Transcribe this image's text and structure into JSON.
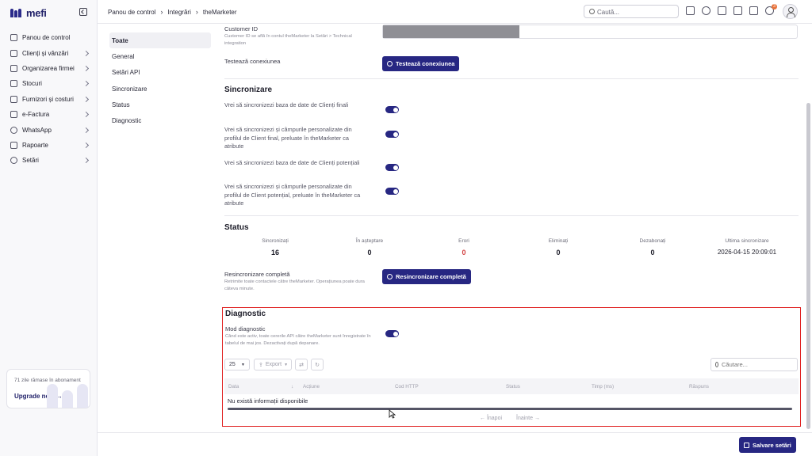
{
  "app": {
    "logo_text": "mefi"
  },
  "sidebar": {
    "items": [
      {
        "label": "Panou de control",
        "icon": "home-icon",
        "chevron": false
      },
      {
        "label": "Clienți și vânzări",
        "icon": "users-icon",
        "chevron": true
      },
      {
        "label": "Organizarea firmei",
        "icon": "building-icon",
        "chevron": true
      },
      {
        "label": "Stocuri",
        "icon": "box-icon",
        "chevron": true
      },
      {
        "label": "Furnizori și costuri",
        "icon": "truck-icon",
        "chevron": true
      },
      {
        "label": "e-Factura",
        "icon": "invoice-icon",
        "chevron": true
      },
      {
        "label": "WhatsApp",
        "icon": "whatsapp-icon",
        "chevron": true
      },
      {
        "label": "Rapoarte",
        "icon": "clipboard-icon",
        "chevron": true
      },
      {
        "label": "Setări",
        "icon": "gear-icon",
        "chevron": true
      }
    ],
    "subscription": {
      "text": "71 zile rămase în abonament",
      "link": "Upgrade now →"
    }
  },
  "topbar": {
    "breadcrumb": [
      "Panou de control",
      "Integrări",
      "theMarketer"
    ],
    "search_placeholder": "Caută...",
    "notification_count": "3"
  },
  "subnav": [
    "Toate",
    "General",
    "Setări API",
    "Sincronizare",
    "Status",
    "Diagnostic"
  ],
  "api": {
    "customer_id_label": "Customer ID",
    "customer_id_help": "Customer ID se află în contul theMarketer la Setări > Technical integration",
    "test_label": "Testează conexiunea",
    "test_button": "Testează conexiunea"
  },
  "sync": {
    "title": "Sincronizare",
    "options": [
      {
        "label": "Vrei să sincronizezi baza de date de Clienți finali",
        "enabled": true
      },
      {
        "label": "Vrei să sincronizezi și câmpurile personalizate din profilul de Client final, preluate în theMarketer ca atribute",
        "enabled": true
      },
      {
        "label": "Vrei să sincronizezi baza de date de Clienți potențiali",
        "enabled": true
      },
      {
        "label": "Vrei să sincronizezi și câmpurile personalizate din profilul de Client potențial, preluate în theMarketer ca atribute",
        "enabled": true
      }
    ]
  },
  "status": {
    "title": "Status",
    "stats": [
      {
        "label": "Sincronizați",
        "value": "16"
      },
      {
        "label": "În așteptare",
        "value": "0"
      },
      {
        "label": "Erori",
        "value": "0"
      },
      {
        "label": "Eliminați",
        "value": "0"
      },
      {
        "label": "Dezabonați",
        "value": "0"
      },
      {
        "label": "Ultima sincronizare",
        "value": "2026-04-15 20:09:01"
      }
    ],
    "resync_label": "Resincronizare completă",
    "resync_help": "Retrimite toate contactele către theMarketer. Operațiunea poate dura câteva minute.",
    "resync_button": "Resincronizare completă"
  },
  "diagnostic": {
    "title": "Diagnostic",
    "mode_label": "Mod diagnostic",
    "mode_help": "Când este activ, toate cererile API către theMarketer sunt înregistrate în tabelul de mai jos. Dezactivați după depanare.",
    "mode_enabled": true,
    "page_size": "25",
    "export_label": "Export",
    "search_placeholder": "Căutare...",
    "columns": [
      "Data",
      "Acțiune",
      "Cod HTTP",
      "Status",
      "Timp (ms)",
      "Răspuns"
    ],
    "empty_text": "Nu există informații disponibile",
    "prev_label": "← Înapoi",
    "next_label": "Înainte →"
  },
  "footer": {
    "save_button": "Salvare setări"
  },
  "colors": {
    "primary": "#272782",
    "highlight_border": "#e02020",
    "error_value": "#d23f3f",
    "badge": "#e8733c"
  }
}
